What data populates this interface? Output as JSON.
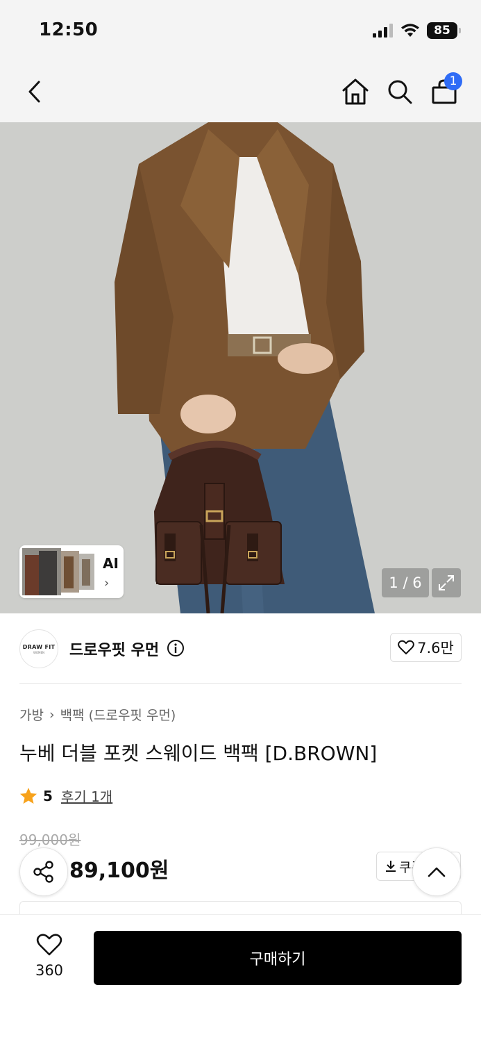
{
  "status_bar": {
    "time": "12:50",
    "battery": "85"
  },
  "nav": {
    "cart_count": "1"
  },
  "gallery": {
    "ai_label": "AI",
    "ai_chevron": "›",
    "counter": "1 / 6"
  },
  "brand": {
    "logo_text": "DRAW FIT",
    "logo_sub": "WOMEN",
    "name": "드로우핏 우먼",
    "likes": "7.6만"
  },
  "product": {
    "breadcrumb": [
      "가방",
      "백팩 (드로우핏 우먼)"
    ],
    "breadcrumb_sep": "›",
    "title": "누베 더블 포켓 스웨이드 백팩 [D.BROWN]",
    "rating": "5",
    "review_link": "후기 1개",
    "original_price": "99,000원",
    "sale_price": "89,100원",
    "coupon_label": "쿠폰"
  },
  "bottom": {
    "wish_count": "360",
    "buy_label": "구매하기"
  },
  "colors": {
    "accent_blue": "#2f6cf6",
    "star": "#f7a21b",
    "discount_red": "#f0432f",
    "buy_bg": "#000000"
  }
}
